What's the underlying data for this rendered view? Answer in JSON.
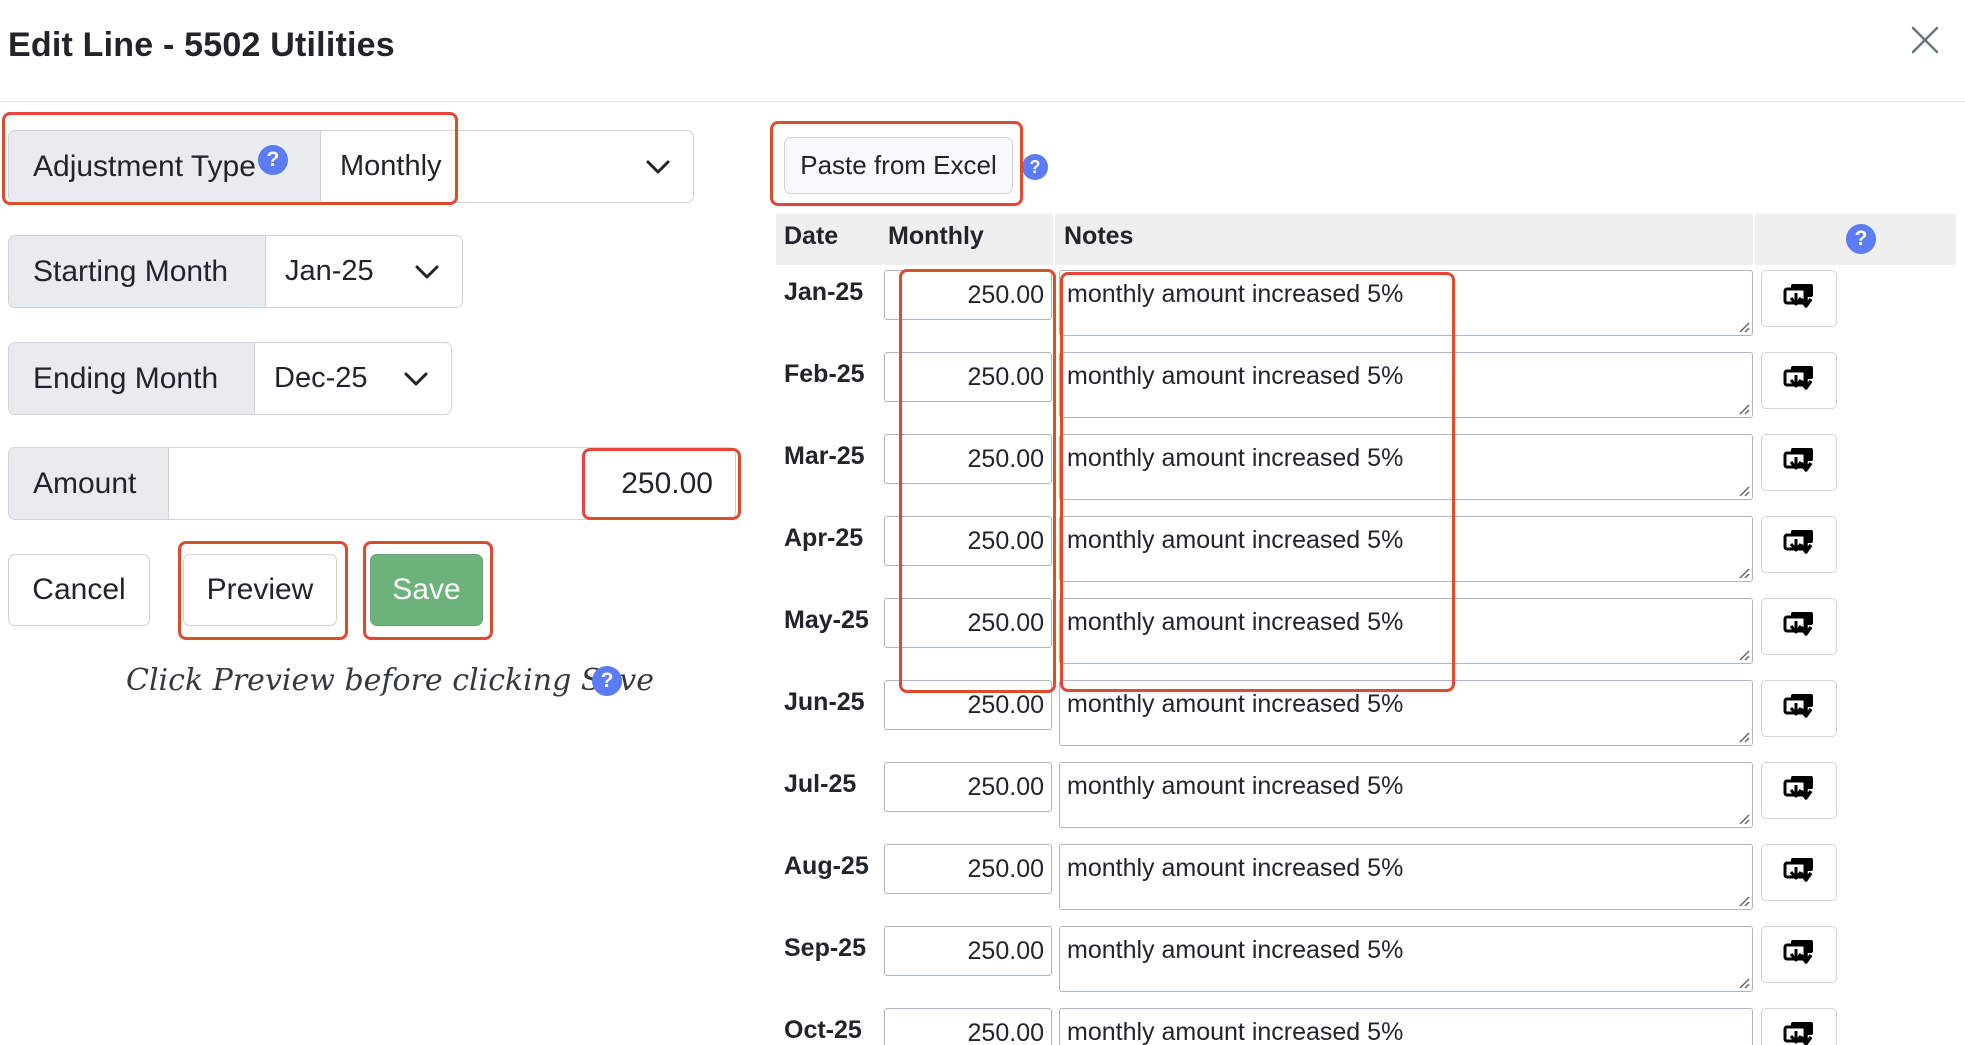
{
  "modal": {
    "title": "Edit Line - 5502 Utilities"
  },
  "form": {
    "adjustment_type": {
      "label": "Adjustment Type",
      "help": "?",
      "value": "Monthly"
    },
    "starting_month": {
      "label": "Starting Month",
      "value": "Jan-25"
    },
    "ending_month": {
      "label": "Ending Month",
      "value": "Dec-25"
    },
    "amount": {
      "label": "Amount",
      "value": "250.00"
    },
    "buttons": {
      "cancel": "Cancel",
      "preview": "Preview",
      "save": "Save"
    },
    "hint": "Click Preview before clicking Save",
    "hint_help": "?"
  },
  "toolbar": {
    "paste_label": "Paste from Excel",
    "paste_help": "?"
  },
  "table": {
    "headers": {
      "date": "Date",
      "monthly": "Monthly",
      "notes": "Notes",
      "help": "?"
    },
    "rows": [
      {
        "date": "Jan-25",
        "monthly": "250.00",
        "notes": "monthly amount increased 5%"
      },
      {
        "date": "Feb-25",
        "monthly": "250.00",
        "notes": "monthly amount increased 5%"
      },
      {
        "date": "Mar-25",
        "monthly": "250.00",
        "notes": "monthly amount increased 5%"
      },
      {
        "date": "Apr-25",
        "monthly": "250.00",
        "notes": "monthly amount increased 5%"
      },
      {
        "date": "May-25",
        "monthly": "250.00",
        "notes": "monthly amount increased 5%"
      },
      {
        "date": "Jun-25",
        "monthly": "250.00",
        "notes": "monthly amount increased 5%"
      },
      {
        "date": "Jul-25",
        "monthly": "250.00",
        "notes": "monthly amount increased 5%"
      },
      {
        "date": "Aug-25",
        "monthly": "250.00",
        "notes": "monthly amount increased 5%"
      },
      {
        "date": "Sep-25",
        "monthly": "250.00",
        "notes": "monthly amount increased 5%"
      },
      {
        "date": "Oct-25",
        "monthly": "250.00",
        "notes": "monthly amount increased 5%"
      }
    ]
  },
  "icons": {
    "close": "close-icon",
    "chevron": "chevron-down-icon",
    "help": "help-icon",
    "row_action": "copy-down-icon",
    "resize": "resize-grip-icon"
  },
  "colors": {
    "help_badge": "#5b7cf5",
    "save_button": "#6db27b",
    "highlight_box": "#e04a35",
    "label_background": "#e9ecef",
    "table_header_background": "#efefef"
  }
}
